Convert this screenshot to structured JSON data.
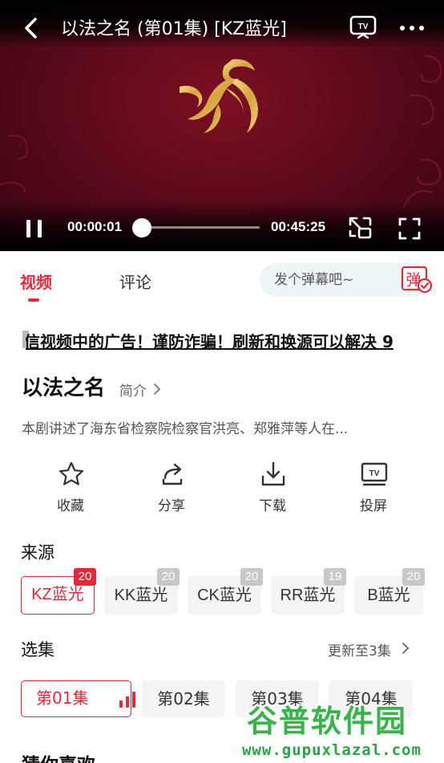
{
  "player": {
    "title": "以法之名 (第01集) [KZ蓝光]",
    "current_time": "00:00:01",
    "total_time": "00:45:25",
    "progress_fraction": 0.0004,
    "accent_color": "#e8263a"
  },
  "tabs": [
    {
      "label": "视频",
      "active": true
    },
    {
      "label": "评论",
      "active": false
    }
  ],
  "danmu": {
    "placeholder": "发个弹幕吧~",
    "icon": "danmu-send-icon"
  },
  "notice": {
    "text": "信视频中的广告！谨防诈骗！刷新和换源可以解决 9"
  },
  "show": {
    "title": "以法之名",
    "intro_label": "简介",
    "synopsis": "本剧讲述了海东省检察院检察官洪亮、郑雅萍等人在..."
  },
  "actions": [
    {
      "label": "收藏",
      "icon": "star-icon"
    },
    {
      "label": "分享",
      "icon": "share-icon"
    },
    {
      "label": "下载",
      "icon": "download-icon"
    },
    {
      "label": "投屏",
      "icon": "cast-tv-icon"
    }
  ],
  "source": {
    "label": "来源",
    "items": [
      {
        "name": "KZ蓝光",
        "count": "20",
        "active": true
      },
      {
        "name": "KK蓝光",
        "count": "20",
        "active": false
      },
      {
        "name": "CK蓝光",
        "count": "20",
        "active": false
      },
      {
        "name": "RR蓝光",
        "count": "19",
        "active": false
      },
      {
        "name": "B蓝光",
        "count": "20",
        "active": false
      }
    ]
  },
  "episodes": {
    "label": "选集",
    "update_text": "更新至3集",
    "items": [
      {
        "name": "第01集",
        "active": true
      },
      {
        "name": "第02集",
        "active": false
      },
      {
        "name": "第03集",
        "active": false
      },
      {
        "name": "第04集",
        "active": false
      }
    ]
  },
  "recommend": {
    "title": "猜你喜欢"
  },
  "watermark": {
    "name": "谷普软件园",
    "url": "www.gupuxlazal.com"
  }
}
